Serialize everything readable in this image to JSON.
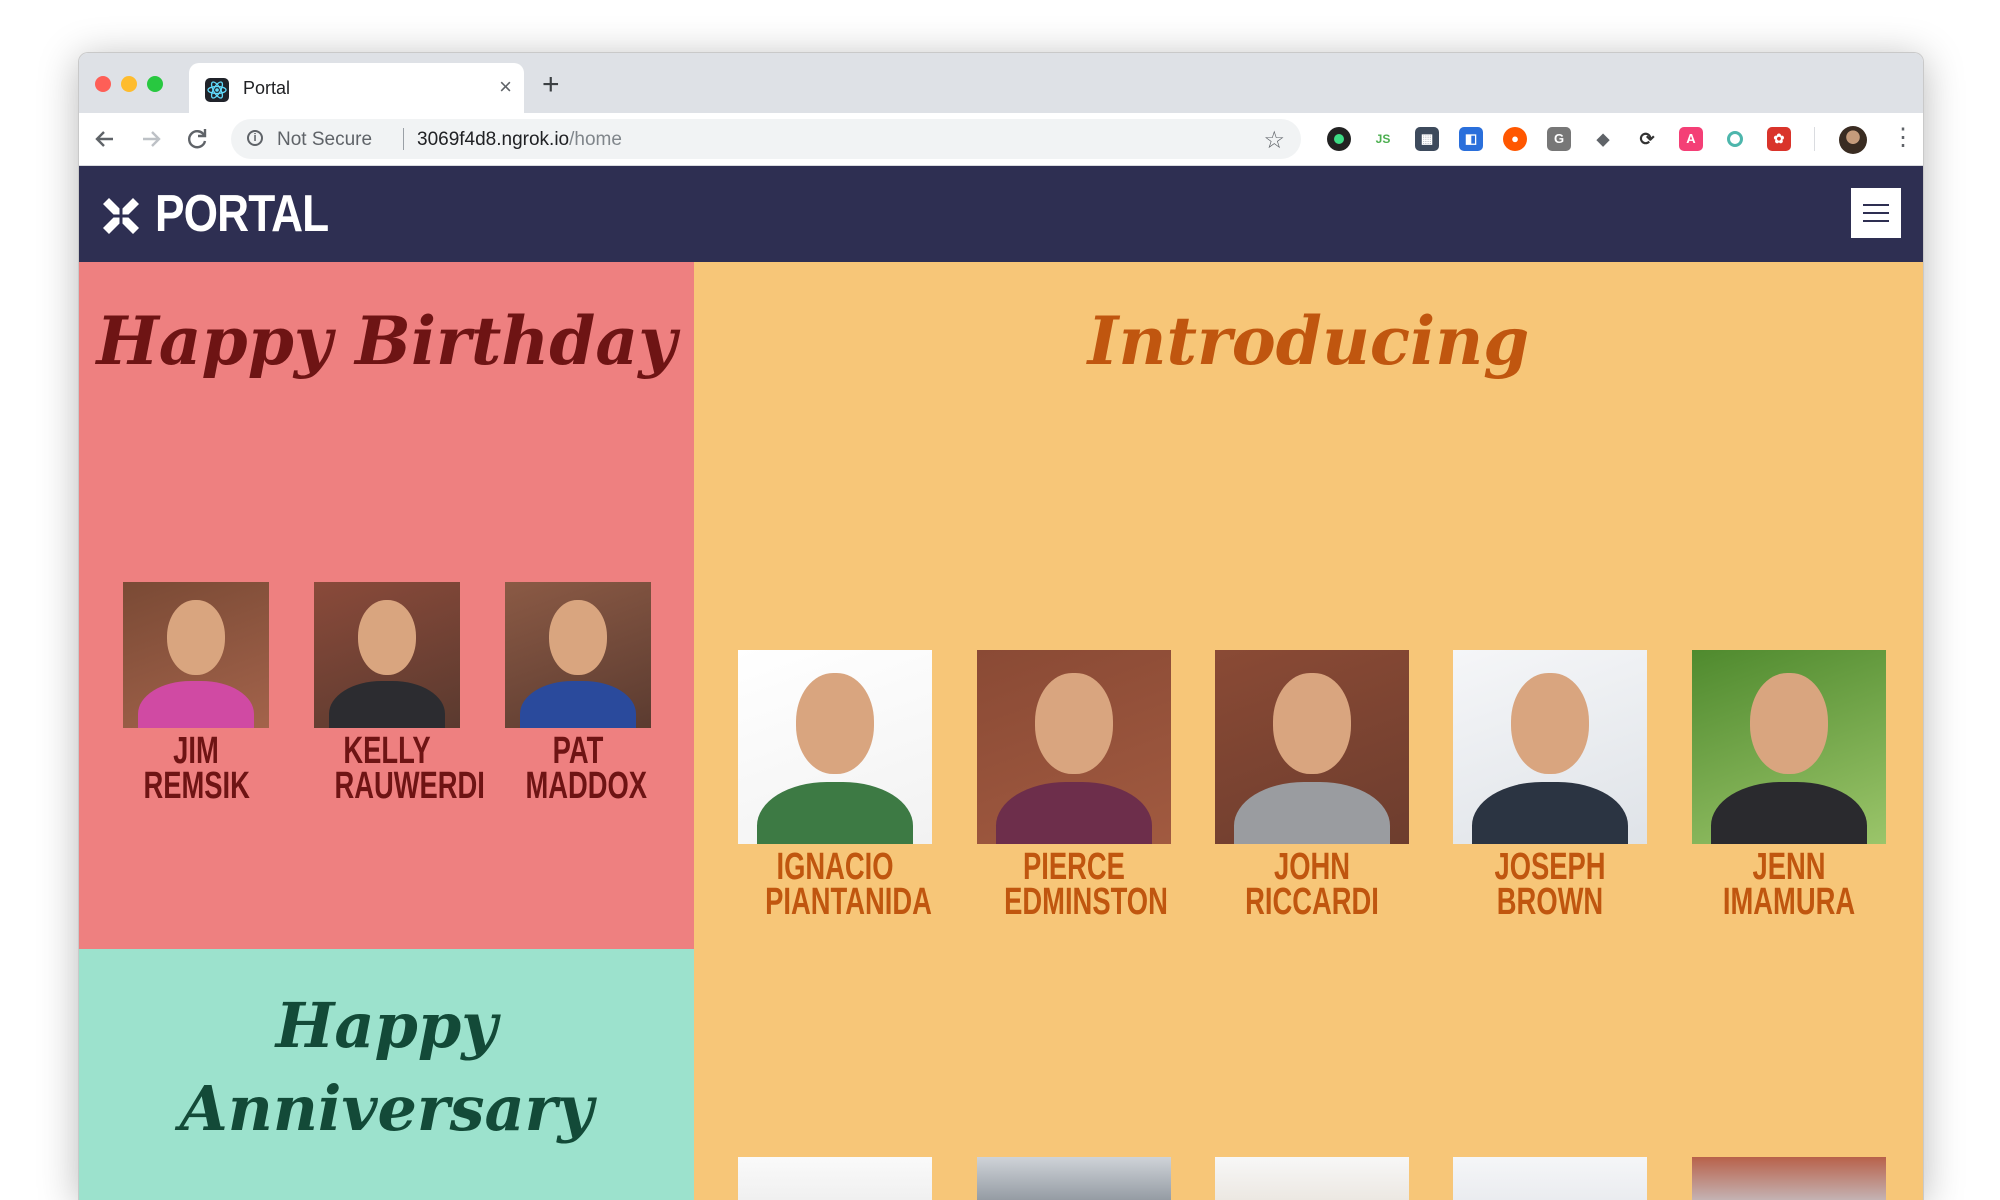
{
  "browser": {
    "tab_title": "Portal",
    "new_tab_symbol": "+",
    "close_symbol": "×",
    "not_secure": "Not Secure",
    "url_host": "3069f4d8.ngrok.io",
    "url_path": "/home",
    "extension_icons": [
      "camera-ext-icon",
      "nodejs-ext-icon",
      "calendar-ext-icon",
      "dev-ext-icon",
      "reddit-ext-icon",
      "g-ext-icon",
      "tag-ext-icon",
      "sync-ext-icon",
      "a-ext-icon",
      "circle-ext-icon",
      "react-ext-icon"
    ]
  },
  "header": {
    "logo_text": "PORTAL"
  },
  "birthday": {
    "title": "Happy Birthday",
    "people": [
      {
        "first": "JIM",
        "last": "REMSIK"
      },
      {
        "first": "KELLY",
        "last": "RAUWERDI"
      },
      {
        "first": "PAT",
        "last": "MADDOX"
      }
    ]
  },
  "introducing": {
    "title": "Introducing",
    "people": [
      {
        "first": "IGNACIO",
        "last": "PIANTANIDA"
      },
      {
        "first": "PIERCE",
        "last": "EDMINSTON"
      },
      {
        "first": "JOHN",
        "last": "RICCARDI"
      },
      {
        "first": "JOSEPH",
        "last": "BROWN"
      },
      {
        "first": "JENN",
        "last": "IMAMURA"
      }
    ]
  },
  "anniversary": {
    "title_line1": "Happy",
    "title_line2": "Anniversary"
  },
  "colors": {
    "header_bg": "#2e2f52",
    "birthday_bg": "#ee8080",
    "birthday_text": "#6e1414",
    "intro_bg": "#f7c678",
    "intro_text": "#c0560f",
    "anniv_bg": "#9ce2cd",
    "anniv_text": "#134a38"
  }
}
